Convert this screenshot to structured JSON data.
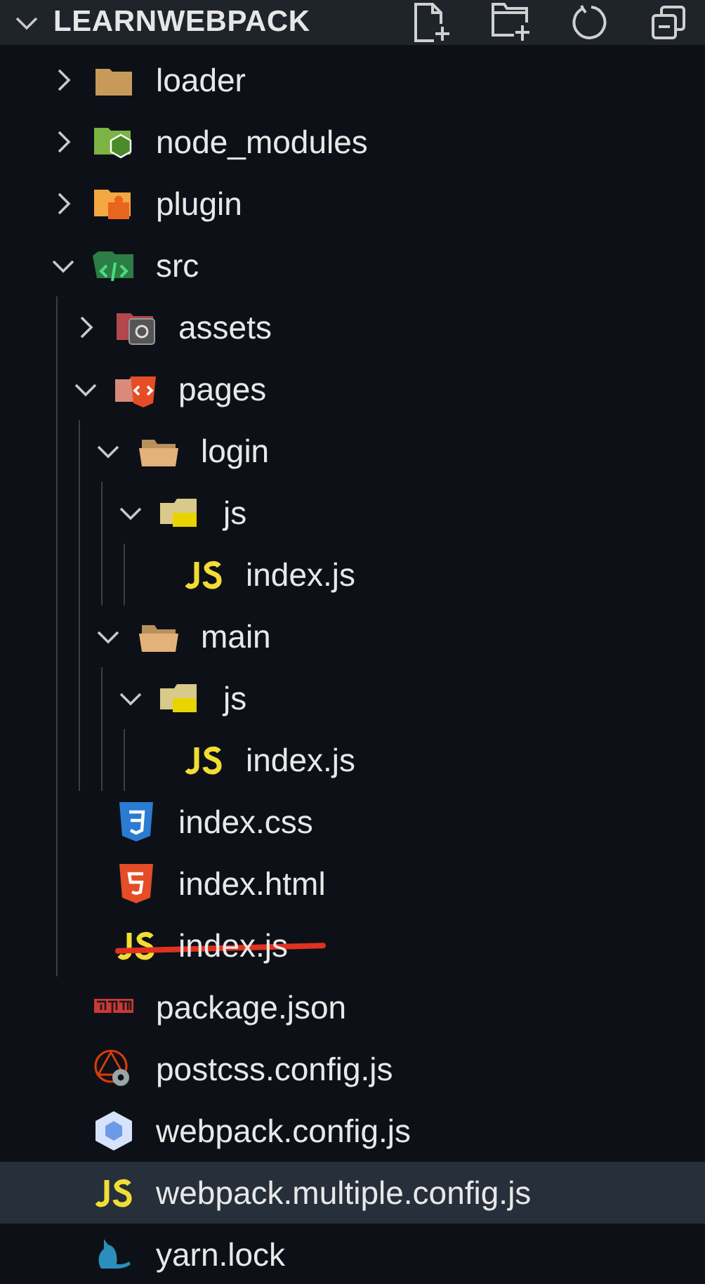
{
  "explorer": {
    "title": "LEARNWEBPACK",
    "expanded": true
  },
  "tree": [
    {
      "label": "loader",
      "kind": "folder",
      "expanded": false,
      "selected": false,
      "struck": false
    },
    {
      "label": "node_modules",
      "kind": "folder-node",
      "expanded": false,
      "selected": false,
      "struck": false
    },
    {
      "label": "plugin",
      "kind": "folder-plugin",
      "expanded": false,
      "selected": false,
      "struck": false
    },
    {
      "label": "src",
      "kind": "folder-src",
      "expanded": true,
      "selected": false,
      "struck": false,
      "children": [
        {
          "label": "assets",
          "kind": "folder-assets",
          "expanded": false,
          "selected": false,
          "struck": false
        },
        {
          "label": "pages",
          "kind": "folder-pages",
          "expanded": true,
          "selected": false,
          "struck": false,
          "children": [
            {
              "label": "login",
              "kind": "folder-open",
              "expanded": true,
              "selected": false,
              "struck": false,
              "children": [
                {
                  "label": "js",
                  "kind": "folder-js",
                  "expanded": true,
                  "selected": false,
                  "struck": false,
                  "children": [
                    {
                      "label": "index.js",
                      "kind": "js",
                      "selected": false,
                      "struck": false
                    }
                  ]
                }
              ]
            },
            {
              "label": "main",
              "kind": "folder-open",
              "expanded": true,
              "selected": false,
              "struck": false,
              "children": [
                {
                  "label": "js",
                  "kind": "folder-js",
                  "expanded": true,
                  "selected": false,
                  "struck": false,
                  "children": [
                    {
                      "label": "index.js",
                      "kind": "js",
                      "selected": false,
                      "struck": false
                    }
                  ]
                }
              ]
            }
          ]
        },
        {
          "label": "index.css",
          "kind": "css",
          "selected": false,
          "struck": false
        },
        {
          "label": "index.html",
          "kind": "html",
          "selected": false,
          "struck": false
        },
        {
          "label": "index.js",
          "kind": "js",
          "selected": false,
          "struck": true
        }
      ]
    },
    {
      "label": "package.json",
      "kind": "npm",
      "selected": false,
      "struck": false
    },
    {
      "label": "postcss.config.js",
      "kind": "postcss",
      "selected": false,
      "struck": false
    },
    {
      "label": "webpack.config.js",
      "kind": "webpack",
      "selected": false,
      "struck": false
    },
    {
      "label": "webpack.multiple.config.js",
      "kind": "js",
      "selected": true,
      "struck": false
    },
    {
      "label": "yarn.lock",
      "kind": "yarn",
      "selected": false,
      "struck": false
    }
  ]
}
